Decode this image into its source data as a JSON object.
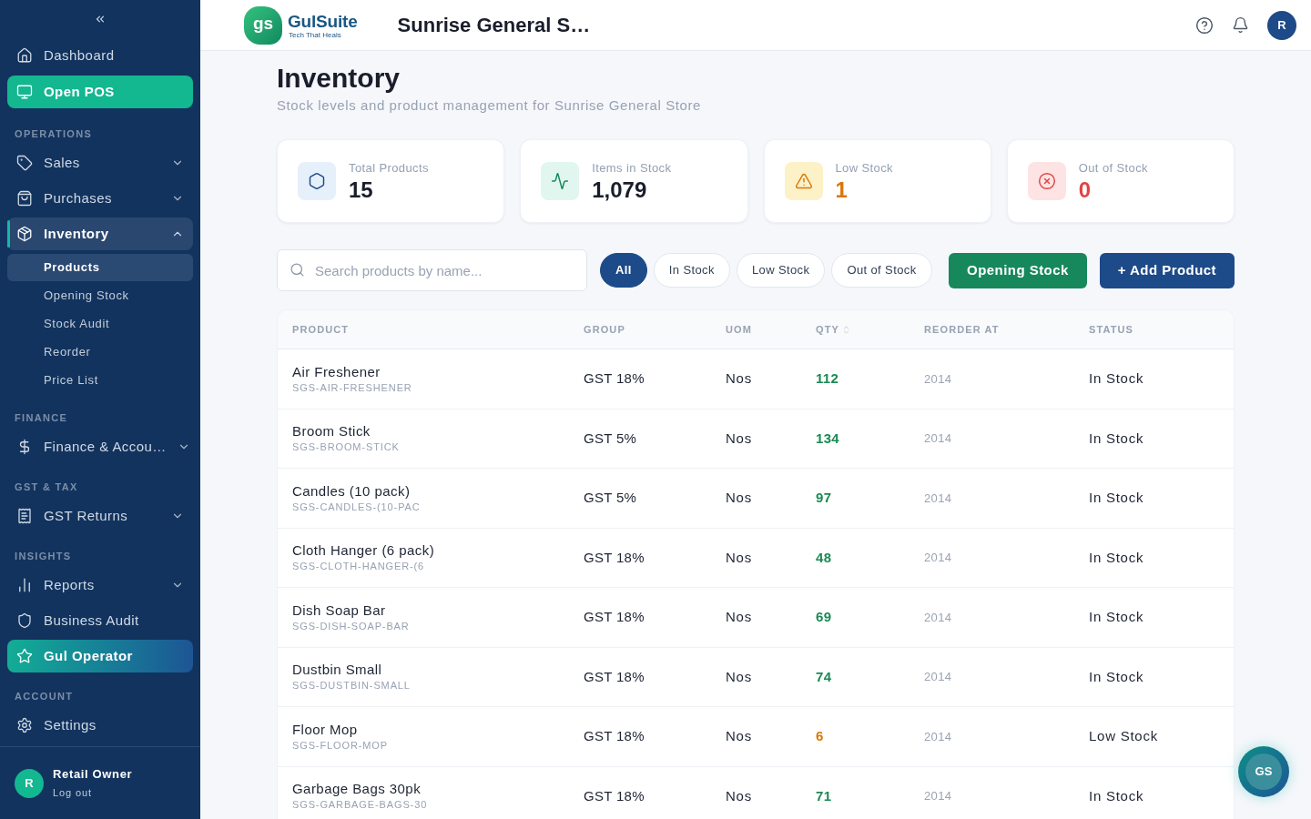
{
  "header": {
    "logo": {
      "mark": "gs",
      "name": "GulSuite",
      "tagline": "Tech That Heals"
    },
    "store_name": "Sunrise General S…",
    "avatar": "R"
  },
  "sidebar": {
    "top_items": [
      {
        "label": "Dashboard",
        "kind": "link",
        "selected": false
      },
      {
        "label": "Open POS",
        "kind": "pos",
        "selected": false
      }
    ],
    "sections": [
      {
        "heading": "OPERATIONS",
        "items": [
          {
            "label": "Sales",
            "kind": "group",
            "expanded": false,
            "selected": false
          },
          {
            "label": "Purchases",
            "kind": "group",
            "expanded": false,
            "selected": false
          },
          {
            "label": "Inventory",
            "kind": "group",
            "expanded": true,
            "selected": true,
            "children": [
              {
                "label": "Products",
                "selected": true
              },
              {
                "label": "Opening Stock",
                "selected": false
              },
              {
                "label": "Stock Audit",
                "selected": false
              },
              {
                "label": "Reorder",
                "selected": false
              },
              {
                "label": "Price List",
                "selected": false
              }
            ]
          }
        ]
      },
      {
        "heading": "FINANCE",
        "items": [
          {
            "label": "Finance & Accou…",
            "kind": "group",
            "expanded": false,
            "selected": false
          }
        ]
      },
      {
        "heading": "GST & TAX",
        "items": [
          {
            "label": "GST Returns",
            "kind": "group",
            "expanded": false,
            "selected": false
          }
        ]
      },
      {
        "heading": "INSIGHTS",
        "items": [
          {
            "label": "Reports",
            "kind": "group",
            "expanded": false,
            "selected": false
          },
          {
            "label": "Business Audit",
            "kind": "link",
            "selected": false
          },
          {
            "label": "Gul Operator",
            "kind": "ai",
            "selected": false
          }
        ]
      },
      {
        "heading": "ACCOUNT",
        "items": [
          {
            "label": "Settings",
            "kind": "link",
            "selected": false
          }
        ]
      }
    ],
    "user": {
      "avatar": "R",
      "name": "Retail Owner",
      "action": "Log out"
    }
  },
  "page": {
    "title": "Inventory",
    "subtitle": "Stock levels and product management for Sunrise General Store"
  },
  "stats": [
    {
      "kind": "total",
      "label": "Total Products",
      "value": "15"
    },
    {
      "kind": "in_stock",
      "label": "Items in Stock",
      "value": "1,079"
    },
    {
      "kind": "low",
      "label": "Low Stock",
      "value": "1"
    },
    {
      "kind": "out",
      "label": "Out of Stock",
      "value": "0"
    }
  ],
  "filters": {
    "search": {
      "placeholder": "Search products by name..."
    },
    "pills": [
      {
        "label": "All",
        "selected": true
      },
      {
        "label": "In Stock",
        "selected": false
      },
      {
        "label": "Low Stock",
        "selected": false
      },
      {
        "label": "Out of Stock",
        "selected": false
      }
    ],
    "buttons": [
      {
        "label": "Opening Stock",
        "kind": "secondary"
      },
      {
        "label": "+ Add Product",
        "kind": "primary"
      }
    ]
  },
  "table": {
    "columns": [
      {
        "label": "PRODUCT",
        "sortable": false
      },
      {
        "label": "GROUP",
        "sortable": false
      },
      {
        "label": "UOM",
        "sortable": false
      },
      {
        "label": "QTY",
        "sortable": true
      },
      {
        "label": "REORDER AT",
        "sortable": false
      },
      {
        "label": "STATUS",
        "sortable": false
      }
    ],
    "rows": [
      {
        "kind": "in_stock",
        "name": "Air Freshener",
        "sku": "SGS-AIR-FRESHENER",
        "group": "GST 18%",
        "uom": "Nos",
        "qty": "112",
        "reorder_at": "2014",
        "status": "In Stock"
      },
      {
        "kind": "in_stock",
        "name": "Broom Stick",
        "sku": "SGS-BROOM-STICK",
        "group": "GST 5%",
        "uom": "Nos",
        "qty": "134",
        "reorder_at": "2014",
        "status": "In Stock"
      },
      {
        "kind": "in_stock",
        "name": "Candles (10 pack)",
        "sku": "SGS-CANDLES-(10-PAC",
        "group": "GST 5%",
        "uom": "Nos",
        "qty": "97",
        "reorder_at": "2014",
        "status": "In Stock"
      },
      {
        "kind": "in_stock",
        "name": "Cloth Hanger (6 pack)",
        "sku": "SGS-CLOTH-HANGER-(6",
        "group": "GST 18%",
        "uom": "Nos",
        "qty": "48",
        "reorder_at": "2014",
        "status": "In Stock"
      },
      {
        "kind": "in_stock",
        "name": "Dish Soap Bar",
        "sku": "SGS-DISH-SOAP-BAR",
        "group": "GST 18%",
        "uom": "Nos",
        "qty": "69",
        "reorder_at": "2014",
        "status": "In Stock"
      },
      {
        "kind": "in_stock",
        "name": "Dustbin Small",
        "sku": "SGS-DUSTBIN-SMALL",
        "group": "GST 18%",
        "uom": "Nos",
        "qty": "74",
        "reorder_at": "2014",
        "status": "In Stock"
      },
      {
        "kind": "low_stock",
        "name": "Floor Mop",
        "sku": "SGS-FLOOR-MOP",
        "group": "GST 18%",
        "uom": "Nos",
        "qty": "6",
        "reorder_at": "2014",
        "status": "Low Stock"
      },
      {
        "kind": "in_stock",
        "name": "Garbage Bags 30pk",
        "sku": "SGS-GARBAGE-BAGS-30",
        "group": "GST 18%",
        "uom": "Nos",
        "qty": "71",
        "reorder_at": "2014",
        "status": "In Stock"
      }
    ]
  },
  "assistant": {
    "label": "GS"
  }
}
